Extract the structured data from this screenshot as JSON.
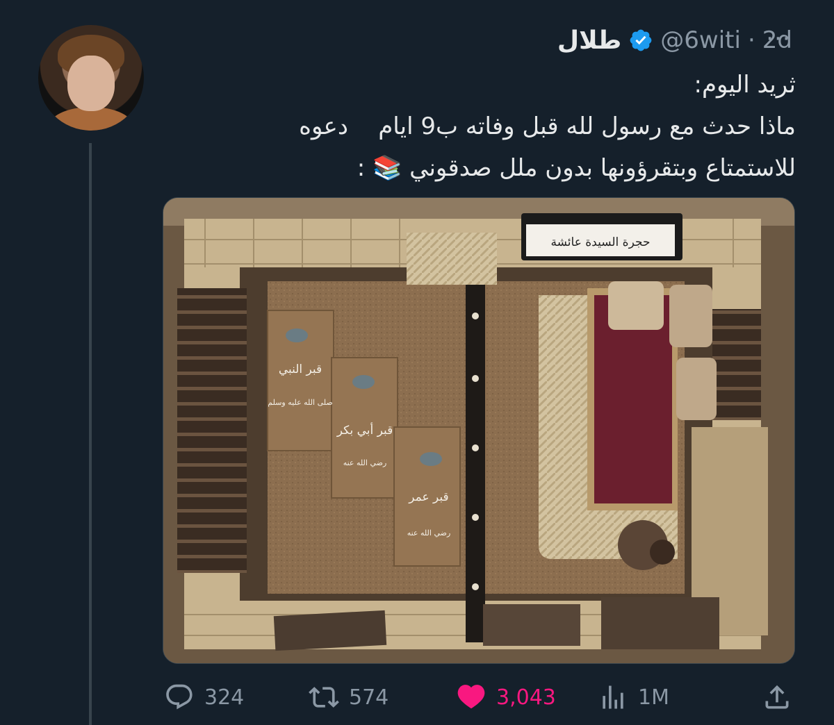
{
  "tweet": {
    "display_name": "طلال",
    "handle": "@6witi",
    "separator": "·",
    "time": "2d",
    "more_label": "···",
    "text_lines": [
      "ثريد اليوم:",
      "ماذا حدث مع رسول لله قبل وفاته ب9 ايام    دعوه",
      "للاستمتاع وبتقرؤونها بدون ملل صدقوني 📚 :"
    ]
  },
  "media": {
    "sign_text": "حجرة السيدة عائشة",
    "grave_prophet": "قبر النبي",
    "grave_prophet_sub": "صلى الله عليه وسلم",
    "grave_abubakr": "قبر أبي بكر",
    "grave_abubakr_sub": "رضي الله عنه",
    "grave_umar": "قبر عمر",
    "grave_umar_sub": "رضي الله عنه"
  },
  "actions": {
    "replies": "324",
    "retweets": "574",
    "likes": "3,043",
    "views": "1M"
  },
  "colors": {
    "background": "#15202b",
    "secondary_text": "#8b98a5",
    "verified": "#1d9bf0",
    "like": "#f91880"
  }
}
